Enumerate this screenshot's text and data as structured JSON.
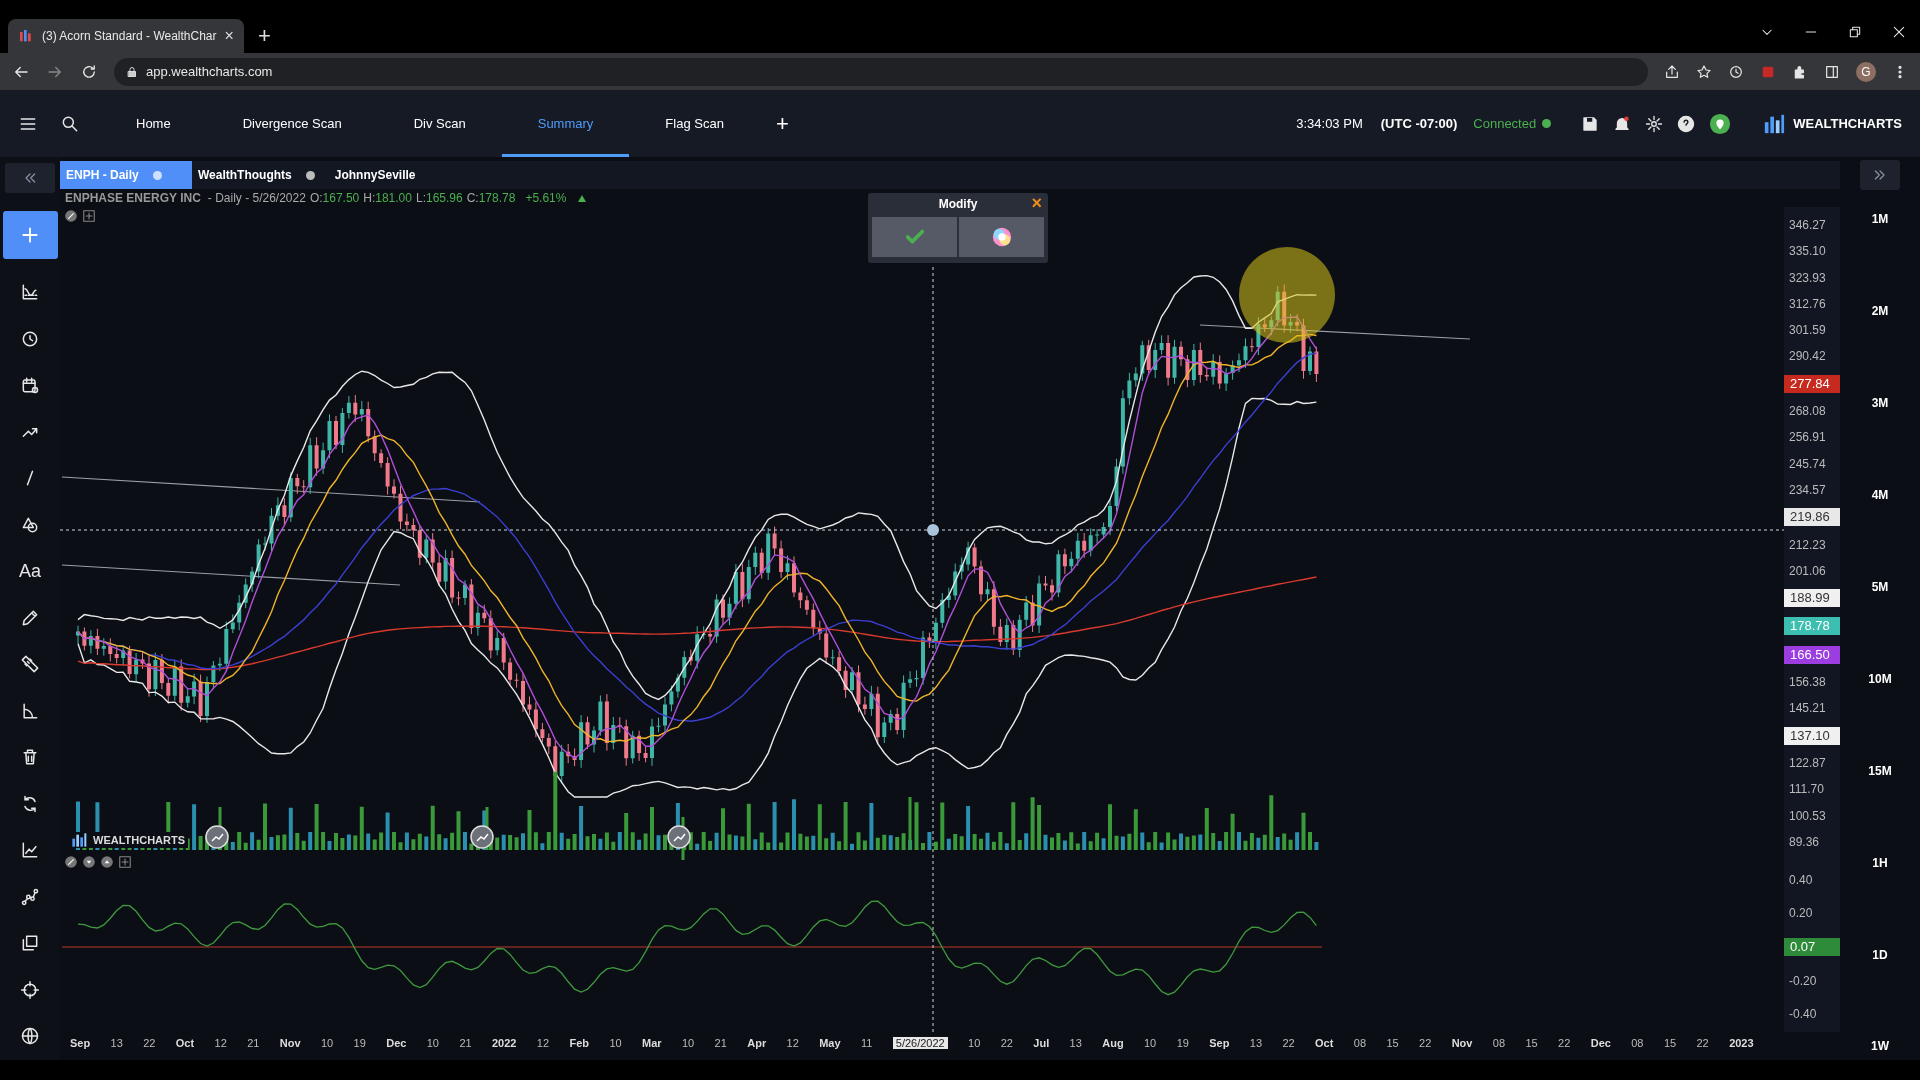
{
  "browser": {
    "tab_title": "(3) Acorn Standard - WealthChar",
    "tab_close": "×",
    "new_tab": "+",
    "url": "app.wealthcharts.com",
    "profile": "G"
  },
  "nav": {
    "items": [
      {
        "label": "Home",
        "selected": false
      },
      {
        "label": "Divergence Scan",
        "selected": false
      },
      {
        "label": "Div Scan",
        "selected": false
      },
      {
        "label": "Summary",
        "selected": true
      },
      {
        "label": "Flag Scan",
        "selected": false
      }
    ],
    "add": "+",
    "time": "3:34:03 PM",
    "timezone": "(UTC -07:00)",
    "status": "Connected",
    "brand": "WEALTHCHARTS"
  },
  "toolbar": {
    "text_tool": "Aa"
  },
  "chart_tabs": [
    {
      "label": "ENPH - Daily",
      "selected": true,
      "dot": true
    },
    {
      "label": "WealthThoughts",
      "selected": false,
      "dot": true
    },
    {
      "label": "JohnnySeville",
      "selected": false,
      "dot": false
    }
  ],
  "symbol_info": {
    "name": "ENPHASE ENERGY INC",
    "description": "- Daily - 5/26/2022",
    "ohlc": [
      {
        "label": "O:",
        "value": "167.50"
      },
      {
        "label": "H:",
        "value": "181.00"
      },
      {
        "label": "L:",
        "value": "165.96"
      },
      {
        "label": "C:",
        "value": "178.78"
      }
    ],
    "change": "+5.61%"
  },
  "modify_popup": {
    "title": "Modify",
    "close": "×"
  },
  "chart_watermark": "WEALTHCHARTS",
  "price_axis": [
    {
      "label": "346.27",
      "kind": "tick"
    },
    {
      "label": "335.10",
      "kind": "tick"
    },
    {
      "label": "323.93",
      "kind": "tick"
    },
    {
      "label": "312.76",
      "kind": "tick"
    },
    {
      "label": "301.59",
      "kind": "tick"
    },
    {
      "label": "290.42",
      "kind": "tick"
    },
    {
      "label": "277.84",
      "kind": "tag",
      "color": "#c62a1f"
    },
    {
      "label": "268.08",
      "kind": "tick"
    },
    {
      "label": "256.91",
      "kind": "tick"
    },
    {
      "label": "245.74",
      "kind": "tick"
    },
    {
      "label": "234.57",
      "kind": "tick"
    },
    {
      "label": "219.86",
      "kind": "tag",
      "color": "#e8e8e8"
    },
    {
      "label": "212.23",
      "kind": "tick"
    },
    {
      "label": "201.06",
      "kind": "tick"
    },
    {
      "label": "188.99",
      "kind": "tag",
      "color": "#f0f0f0"
    },
    {
      "label": "178.78",
      "kind": "tag",
      "color": "#3cbfb0"
    },
    {
      "label": "166.50",
      "kind": "tag",
      "color": "#9b3de0"
    },
    {
      "label": "156.38",
      "kind": "tick"
    },
    {
      "label": "145.21",
      "kind": "tick"
    },
    {
      "label": "137.10",
      "kind": "tag",
      "color": "#f0f0f0"
    },
    {
      "label": "122.87",
      "kind": "tick"
    },
    {
      "label": "111.70",
      "kind": "tick"
    },
    {
      "label": "100.53",
      "kind": "tick"
    },
    {
      "label": "89.36",
      "kind": "tick"
    }
  ],
  "oscillator_axis": [
    {
      "label": "0.40",
      "kind": "tick"
    },
    {
      "label": "0.20",
      "kind": "tick"
    },
    {
      "label": "0.07",
      "kind": "tag",
      "color": "#2e8b3a"
    },
    {
      "label": "-0.20",
      "kind": "tick"
    },
    {
      "label": "-0.40",
      "kind": "tick"
    }
  ],
  "time_axis": [
    {
      "label": "Sep",
      "kind": "major"
    },
    {
      "label": "13",
      "kind": "minor"
    },
    {
      "label": "22",
      "kind": "minor"
    },
    {
      "label": "Oct",
      "kind": "major"
    },
    {
      "label": "12",
      "kind": "minor"
    },
    {
      "label": "21",
      "kind": "minor"
    },
    {
      "label": "Nov",
      "kind": "major"
    },
    {
      "label": "10",
      "kind": "minor"
    },
    {
      "label": "19",
      "kind": "minor"
    },
    {
      "label": "Dec",
      "kind": "major"
    },
    {
      "label": "10",
      "kind": "minor"
    },
    {
      "label": "21",
      "kind": "minor"
    },
    {
      "label": "2022",
      "kind": "major"
    },
    {
      "label": "12",
      "kind": "minor"
    },
    {
      "label": "Feb",
      "kind": "major"
    },
    {
      "label": "10",
      "kind": "minor"
    },
    {
      "label": "Mar",
      "kind": "major"
    },
    {
      "label": "10",
      "kind": "minor"
    },
    {
      "label": "21",
      "kind": "minor"
    },
    {
      "label": "Apr",
      "kind": "major"
    },
    {
      "label": "12",
      "kind": "minor"
    },
    {
      "label": "May",
      "kind": "major"
    },
    {
      "label": "11",
      "kind": "minor"
    },
    {
      "label": "5/26/2022",
      "kind": "cursor"
    },
    {
      "label": "10",
      "kind": "minor"
    },
    {
      "label": "22",
      "kind": "minor"
    },
    {
      "label": "Jul",
      "kind": "major"
    },
    {
      "label": "13",
      "kind": "minor"
    },
    {
      "label": "Aug",
      "kind": "major"
    },
    {
      "label": "10",
      "kind": "minor"
    },
    {
      "label": "19",
      "kind": "minor"
    },
    {
      "label": "Sep",
      "kind": "major"
    },
    {
      "label": "13",
      "kind": "minor"
    },
    {
      "label": "22",
      "kind": "minor"
    },
    {
      "label": "Oct",
      "kind": "major"
    },
    {
      "label": "08",
      "kind": "minor"
    },
    {
      "label": "15",
      "kind": "minor"
    },
    {
      "label": "22",
      "kind": "minor"
    },
    {
      "label": "Nov",
      "kind": "major"
    },
    {
      "label": "08",
      "kind": "minor"
    },
    {
      "label": "15",
      "kind": "minor"
    },
    {
      "label": "22",
      "kind": "minor"
    },
    {
      "label": "Dec",
      "kind": "major"
    },
    {
      "label": "08",
      "kind": "minor"
    },
    {
      "label": "15",
      "kind": "minor"
    },
    {
      "label": "22",
      "kind": "minor"
    },
    {
      "label": "2023",
      "kind": "major"
    }
  ],
  "timeframes": [
    "1M",
    "2M",
    "3M",
    "4M",
    "5M",
    "10M",
    "15M",
    "1H",
    "1D",
    "1W"
  ]
}
